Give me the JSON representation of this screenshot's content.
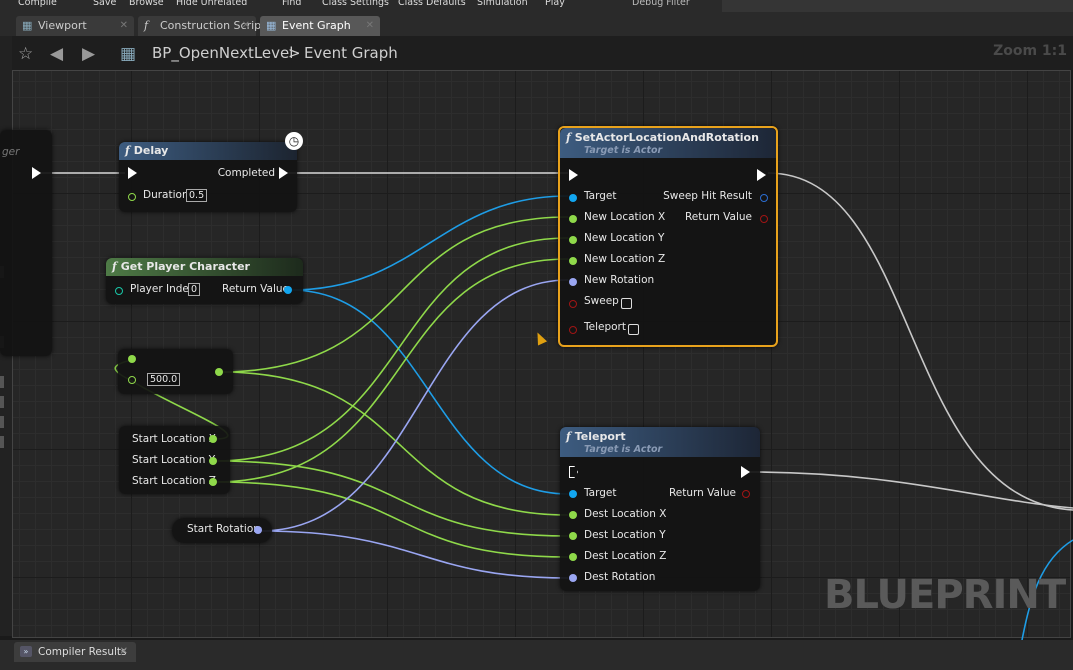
{
  "toolbar": {
    "items": [
      "Compile",
      "Save",
      "Browse",
      "Hide Unrelated",
      "Find",
      "Class Settings",
      "Class Defaults",
      "Simulation",
      "Play",
      "Debug Filter"
    ]
  },
  "tabs": [
    {
      "label": "Viewport",
      "icon": "viewport-icon"
    },
    {
      "label": "Construction Scrip",
      "icon": "function-icon"
    },
    {
      "label": "Event Graph",
      "icon": "event-graph-icon"
    }
  ],
  "breadcrumb": {
    "blueprint": "BP_OpenNextLevel",
    "graph": "Event Graph",
    "separator": ">",
    "zoom": "Zoom 1:1"
  },
  "watermark": "BLUEPRINT",
  "colors": {
    "exec": "#ffffff",
    "object": "#12a6f0",
    "float": "#8fd94a",
    "rotator": "#9aa6f2",
    "bool": "#8e0b0b",
    "selected": "#e8a21c",
    "header_blue": "#355472",
    "header_green": "#3b5a36"
  },
  "nodes": {
    "partial": {
      "label": "ger"
    },
    "delay": {
      "title": "Delay",
      "completed": "Completed",
      "duration_label": "Duration",
      "duration_value": "0.5"
    },
    "get_player": {
      "title": "Get Player Character",
      "index_label": "Player Index",
      "index_value": "0",
      "return_label": "Return Value"
    },
    "add": {
      "value": "500.0"
    },
    "break_vec": {
      "x": "Start Location X",
      "y": "Start Location Y",
      "z": "Start Location Z"
    },
    "start_rot": {
      "label": "Start Rotation"
    },
    "set_actor": {
      "title": "SetActorLocationAndRotation",
      "subtitle": "Target is Actor",
      "target": "Target",
      "new_x": "New Location X",
      "new_y": "New Location Y",
      "new_z": "New Location Z",
      "new_rot": "New Rotation",
      "sweep": "Sweep",
      "teleport": "Teleport",
      "sweep_hit": "Sweep Hit Result",
      "return": "Return Value"
    },
    "teleport": {
      "title": "Teleport",
      "subtitle": "Target is Actor",
      "target": "Target",
      "dest_x": "Dest Location X",
      "dest_y": "Dest Location Y",
      "dest_z": "Dest Location Z",
      "dest_rot": "Dest Rotation",
      "return": "Return Value"
    }
  },
  "bottom_tab": {
    "label": "Compiler Results"
  }
}
